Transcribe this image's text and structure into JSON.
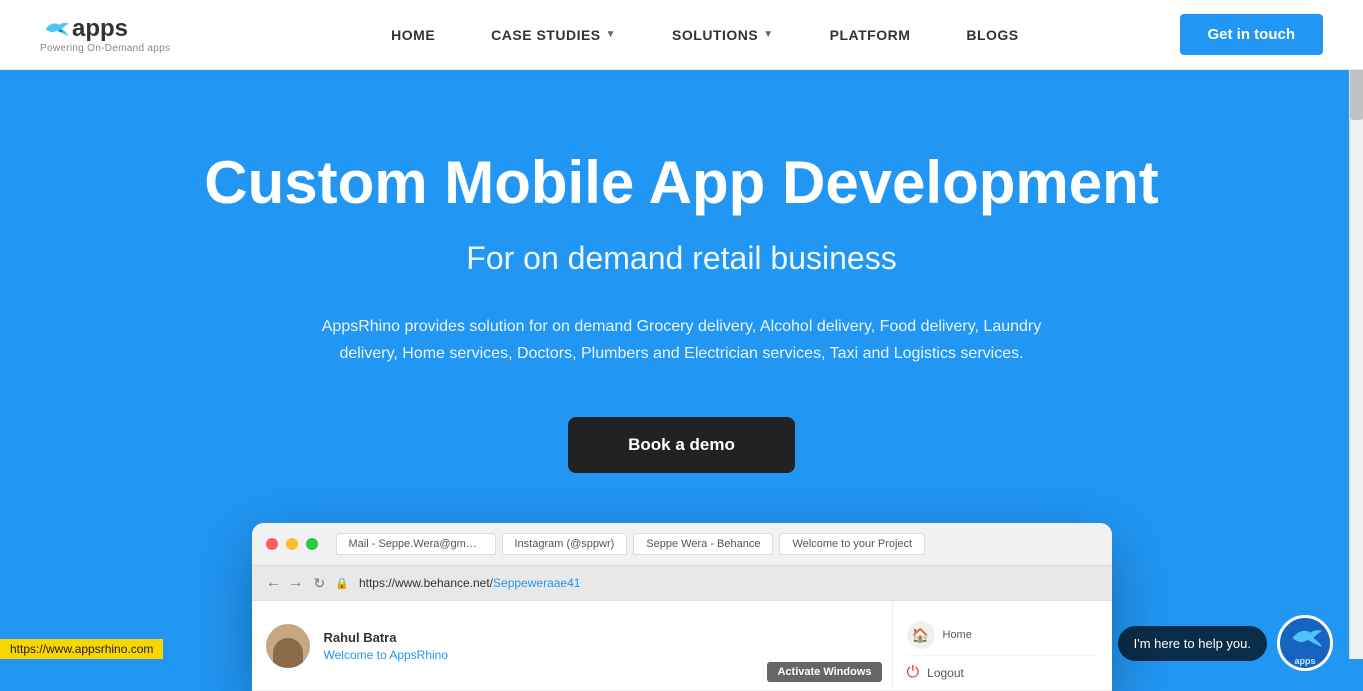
{
  "nav": {
    "logo_text": "apps",
    "logo_tagline": "Powering On-Demand apps",
    "links": [
      {
        "label": "HOME",
        "has_dropdown": false
      },
      {
        "label": "CASE STUDIES",
        "has_dropdown": true
      },
      {
        "label": "SOLUTIONS",
        "has_dropdown": true
      },
      {
        "label": "PLATFORM",
        "has_dropdown": false
      },
      {
        "label": "BLOGS",
        "has_dropdown": false
      }
    ],
    "cta_label": "Get in touch"
  },
  "hero": {
    "title": "Custom Mobile App Development",
    "subtitle": "For on demand retail business",
    "description": "AppsRhino provides solution for on demand Grocery delivery, Alcohol delivery, Food delivery, Laundry delivery, Home services, Doctors, Plumbers and Electrician services, Taxi and Logistics services.",
    "cta_label": "Book a demo"
  },
  "browser": {
    "tabs": [
      "Mail - Seppe.Wera@gmail.com",
      "Instagram (@sppwr)",
      "Seppe Wera - Behance",
      "Welcome to your Project"
    ],
    "url_prefix": "https://www.behance.net/",
    "url_highlight": "Seppeweraae41",
    "user_name": "Rahul Batra",
    "user_welcome": "Welcome to ",
    "user_platform": "AppsRhino",
    "logout_text": "Logout"
  },
  "chat": {
    "bubble_text": "I'm here to help you.",
    "avatar_label": "apps"
  },
  "activate_banner": {
    "text": "Activate Windows"
  },
  "status_bar": {
    "url": "https://www.appsrhino.com"
  }
}
